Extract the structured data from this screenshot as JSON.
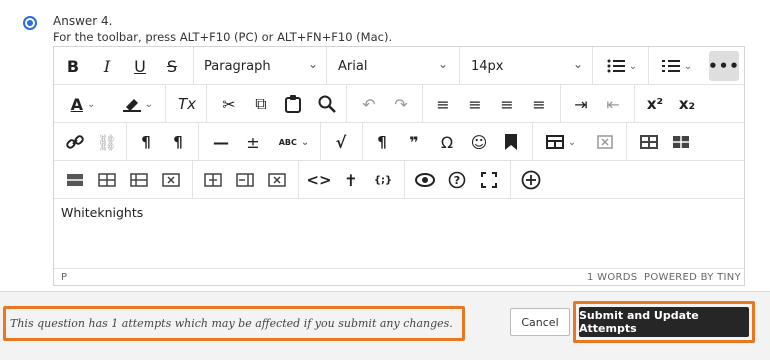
{
  "question": {
    "answer_label": "Answer 4.",
    "toolbar_hint": "For the toolbar, press ALT+F10 (PC) or ALT+FN+F10 (Mac)."
  },
  "toolbar": {
    "block_format": "Paragraph",
    "font_family": "Arial",
    "font_size": "14px",
    "glyphs": {
      "bold": "B",
      "italic": "I",
      "underline": "U",
      "strike": "S",
      "more": "•••",
      "font_color": "A",
      "clear": "Tx",
      "cut": "✂",
      "copy": "⧉",
      "paste": "📋",
      "find": "🔍",
      "undo": "↶",
      "redo": "↷",
      "align_left": "≡",
      "align_center": "≡",
      "align_right": "≡",
      "align_justify": "≡",
      "indent": "⇥",
      "outdent": "⇤",
      "superscript": "x²",
      "subscript": "x₂",
      "link": "🔗",
      "unlink": "⛓",
      "ltr": "¶",
      "rtl": "¶",
      "hr": "—",
      "plusminus": "±",
      "spellcheck": "ABC",
      "formula": "√",
      "pilcrow": "¶",
      "quote": "❞",
      "omega": "Ω",
      "emoji": "☺",
      "bookmark": "▮",
      "code": "<>",
      "accessibility": "✝",
      "curly": "{;}",
      "preview": "👁",
      "help": "?",
      "fullscreen": "⛶",
      "add": "⊕"
    }
  },
  "editor": {
    "content": "Whiteknights",
    "path": "P",
    "word_count": "1 WORDS",
    "powered_by": "POWERED BY TINY"
  },
  "footer": {
    "warning": "This question has 1 attempts which may be affected if you submit any changes.",
    "cancel_label": "Cancel",
    "submit_label": "Submit and Update Attempts",
    "highlight_color": "#e87722"
  }
}
